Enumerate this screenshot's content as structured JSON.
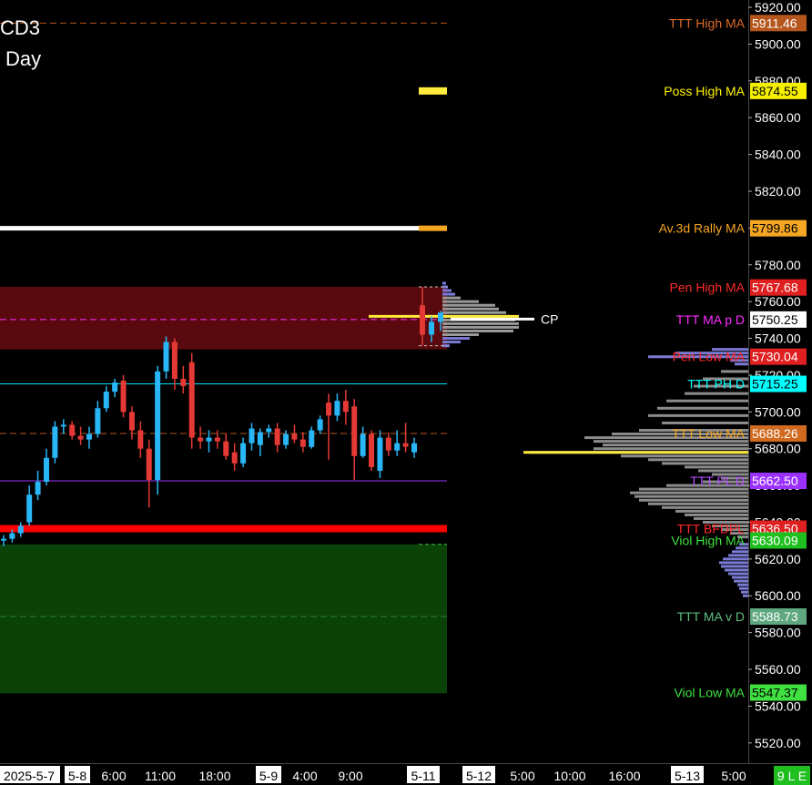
{
  "title_lines": [
    "CD3",
    "Day"
  ],
  "colors": {
    "bull": "#29b6f6",
    "bear": "#e53935",
    "yellow": "#ffeb3b",
    "white": "#ffffff"
  },
  "chart_data": {
    "type": "candlestick",
    "ylim": [
      5509,
      5924
    ],
    "y_ticks": [
      "5520.00",
      "5540.00",
      "5560.00",
      "5580.00",
      "5600.00",
      "5620.00",
      "5640.00",
      "5660.00",
      "5680.00",
      "5700.00",
      "5720.00",
      "5740.00",
      "5760.00",
      "5780.00",
      "5800.00",
      "5820.00",
      "5840.00",
      "5860.00",
      "5880.00",
      "5900.00",
      "5920.00"
    ],
    "x_labels": [
      "2025-5-7",
      "5-8",
      "6:00",
      "11:00",
      "18:00",
      "5-9",
      "4:00",
      "9:00",
      "5-11",
      "5-12",
      "5:00",
      "10:00",
      "16:00",
      "5-13",
      "5:00"
    ],
    "x_label_highlight": [
      "2025-5-7",
      "5-8",
      "5-9",
      "5-11",
      "5-12",
      "5-13"
    ],
    "corner_badge": "9 L E",
    "candles": [
      {
        "o": 5630,
        "h": 5633,
        "l": 5627,
        "c": 5631
      },
      {
        "o": 5631,
        "h": 5636,
        "l": 5629,
        "c": 5634
      },
      {
        "o": 5634,
        "h": 5640,
        "l": 5632,
        "c": 5638
      },
      {
        "o": 5640,
        "h": 5660,
        "l": 5638,
        "c": 5655
      },
      {
        "o": 5655,
        "h": 5668,
        "l": 5652,
        "c": 5662
      },
      {
        "o": 5662,
        "h": 5680,
        "l": 5660,
        "c": 5675
      },
      {
        "o": 5675,
        "h": 5695,
        "l": 5672,
        "c": 5692
      },
      {
        "o": 5692,
        "h": 5696,
        "l": 5688,
        "c": 5693
      },
      {
        "o": 5693,
        "h": 5695,
        "l": 5685,
        "c": 5687
      },
      {
        "o": 5687,
        "h": 5692,
        "l": 5682,
        "c": 5685
      },
      {
        "o": 5685,
        "h": 5692,
        "l": 5680,
        "c": 5688
      },
      {
        "o": 5688,
        "h": 5706,
        "l": 5686,
        "c": 5702
      },
      {
        "o": 5702,
        "h": 5714,
        "l": 5700,
        "c": 5711
      },
      {
        "o": 5711,
        "h": 5718,
        "l": 5708,
        "c": 5716
      },
      {
        "o": 5717,
        "h": 5720,
        "l": 5697,
        "c": 5700
      },
      {
        "o": 5700,
        "h": 5703,
        "l": 5685,
        "c": 5690
      },
      {
        "o": 5690,
        "h": 5695,
        "l": 5675,
        "c": 5680
      },
      {
        "o": 5680,
        "h": 5685,
        "l": 5648,
        "c": 5663
      },
      {
        "o": 5663,
        "h": 5725,
        "l": 5655,
        "c": 5722
      },
      {
        "o": 5722,
        "h": 5741,
        "l": 5718,
        "c": 5738
      },
      {
        "o": 5738,
        "h": 5740,
        "l": 5712,
        "c": 5718
      },
      {
        "o": 5718,
        "h": 5725,
        "l": 5710,
        "c": 5714
      },
      {
        "o": 5727,
        "h": 5732,
        "l": 5680,
        "c": 5686
      },
      {
        "o": 5686,
        "h": 5692,
        "l": 5680,
        "c": 5684
      },
      {
        "o": 5684,
        "h": 5690,
        "l": 5678,
        "c": 5686
      },
      {
        "o": 5686,
        "h": 5690,
        "l": 5680,
        "c": 5684
      },
      {
        "o": 5684,
        "h": 5688,
        "l": 5674,
        "c": 5676
      },
      {
        "o": 5678,
        "h": 5683,
        "l": 5668,
        "c": 5672
      },
      {
        "o": 5672,
        "h": 5686,
        "l": 5670,
        "c": 5683
      },
      {
        "o": 5683,
        "h": 5694,
        "l": 5679,
        "c": 5691
      },
      {
        "o": 5682,
        "h": 5691,
        "l": 5676,
        "c": 5689
      },
      {
        "o": 5689,
        "h": 5693,
        "l": 5686,
        "c": 5691
      },
      {
        "o": 5691,
        "h": 5694,
        "l": 5678,
        "c": 5682
      },
      {
        "o": 5682,
        "h": 5690,
        "l": 5680,
        "c": 5688
      },
      {
        "o": 5688,
        "h": 5693,
        "l": 5683,
        "c": 5685
      },
      {
        "o": 5685,
        "h": 5689,
        "l": 5678,
        "c": 5681
      },
      {
        "o": 5681,
        "h": 5692,
        "l": 5680,
        "c": 5690
      },
      {
        "o": 5690,
        "h": 5698,
        "l": 5688,
        "c": 5696
      },
      {
        "o": 5705,
        "h": 5710,
        "l": 5674,
        "c": 5698
      },
      {
        "o": 5698,
        "h": 5710,
        "l": 5695,
        "c": 5706
      },
      {
        "o": 5706,
        "h": 5712,
        "l": 5693,
        "c": 5700
      },
      {
        "o": 5703,
        "h": 5707,
        "l": 5663,
        "c": 5676
      },
      {
        "o": 5676,
        "h": 5692,
        "l": 5675,
        "c": 5688
      },
      {
        "o": 5688,
        "h": 5690,
        "l": 5668,
        "c": 5670
      },
      {
        "o": 5668,
        "h": 5690,
        "l": 5664,
        "c": 5686
      },
      {
        "o": 5686,
        "h": 5689,
        "l": 5676,
        "c": 5679
      },
      {
        "o": 5679,
        "h": 5690,
        "l": 5676,
        "c": 5683
      },
      {
        "o": 5683,
        "h": 5694,
        "l": 5678,
        "c": 5681
      },
      {
        "o": 5678,
        "h": 5686,
        "l": 5675,
        "c": 5683
      },
      {
        "o": 5758,
        "h": 5768,
        "l": 5736,
        "c": 5742
      },
      {
        "o": 5742,
        "h": 5752,
        "l": 5738,
        "c": 5749
      },
      {
        "o": 5749,
        "h": 5755,
        "l": 5744,
        "c": 5754
      }
    ],
    "zones": [
      {
        "name": "red-zone",
        "top": 5768,
        "bottom": 5734,
        "color": "#5a0a0e"
      },
      {
        "name": "green-zone",
        "top": 5628,
        "bottom": 5547,
        "color": "#0a4207"
      }
    ],
    "levels": [
      {
        "label": "TTT High MA",
        "value": "5911.46",
        "y": 5911.46,
        "text_color": "#e06a2a",
        "box_bg": "#b5561d",
        "box_fg": "#ffffff",
        "line": "dash",
        "line_color": "#b5561d",
        "line_width": 1
      },
      {
        "label": "Poss High MA",
        "value": "5874.55",
        "y": 5874.55,
        "text_color": "#fff200",
        "box_bg": "#f5f000",
        "box_fg": "#000000",
        "line": "none",
        "line_color": "#fff200",
        "line_width": 0
      },
      {
        "label": "Av.3d Rally MA",
        "value": "5799.86",
        "y": 5799.86,
        "text_color": "#f5a623",
        "box_bg": "#f5a623",
        "box_fg": "#000000",
        "line": "solid",
        "line_color": "#ffffff",
        "line_width": 5
      },
      {
        "label": "Pen High MA",
        "value": "5767.68",
        "y": 5767.68,
        "text_color": "#ff2a2a",
        "box_bg": "#e02020",
        "box_fg": "#ffffff",
        "line": "none",
        "line_color": "#e02020",
        "line_width": 0
      },
      {
        "label": "TTT MA p D",
        "value": "5750.25",
        "y": 5750.25,
        "text_color": "#ff2aff",
        "box_bg": "#ffffff",
        "box_fg": "#000000",
        "line": "dash",
        "line_color": "#ff2aff",
        "line_width": 1
      },
      {
        "label": "Pen Low MA",
        "value": "5730.04",
        "y": 5730.04,
        "text_color": "#ff2a2a",
        "box_bg": "#e02020",
        "box_fg": "#ffffff",
        "line": "none",
        "line_color": "#e02020",
        "line_width": 0
      },
      {
        "label": "TTT PH D",
        "value": "5715.25",
        "y": 5715.25,
        "text_color": "#00ffff",
        "box_bg": "#00ffff",
        "box_fg": "#000000",
        "line": "solid",
        "line_color": "#00e5ff",
        "line_width": 1
      },
      {
        "label": "TTT Low MA",
        "value": "5688.26",
        "y": 5688.26,
        "text_color": "#f5a623",
        "box_bg": "#d06a20",
        "box_fg": "#ffffff",
        "line": "dash",
        "line_color": "#b5561d",
        "line_width": 1
      },
      {
        "label": "TTT PL D",
        "value": "5662.50",
        "y": 5662.5,
        "text_color": "#b44dff",
        "box_bg": "#9b30ff",
        "box_fg": "#ffffff",
        "line": "solid",
        "line_color": "#9b30ff",
        "line_width": 1
      },
      {
        "label": "TTT BFDPL",
        "value": "5636.50",
        "y": 5636.5,
        "text_color": "#ff2a2a",
        "box_bg": "#e02020",
        "box_fg": "#ffffff",
        "line": "solid",
        "line_color": "#ff0000",
        "line_width": 8
      },
      {
        "label": "Viol High MA",
        "value": "5630.09",
        "y": 5630.09,
        "text_color": "#40e040",
        "box_bg": "#1fbf1f",
        "box_fg": "#ffffff",
        "line": "none",
        "line_color": "#1fbf1f",
        "line_width": 0
      },
      {
        "label": "TTT MA v D",
        "value": "5588.73",
        "y": 5588.73,
        "text_color": "#5fbf7f",
        "box_bg": "#5fa87f",
        "box_fg": "#ffffff",
        "line": "dash",
        "line_color": "#2f7f3f",
        "line_width": 1
      },
      {
        "label": "Viol Low MA",
        "value": "5547.37",
        "y": 5547.37,
        "text_color": "#40e040",
        "box_bg": "#40e040",
        "box_fg": "#000000",
        "line": "none",
        "line_color": "#40e040",
        "line_width": 0
      }
    ],
    "cp_label": "CP",
    "profile_small": [
      {
        "p": 5770,
        "w": 4
      },
      {
        "p": 5768,
        "w": 6
      },
      {
        "p": 5766,
        "w": 10
      },
      {
        "p": 5764,
        "w": 14
      },
      {
        "p": 5762,
        "w": 20
      },
      {
        "p": 5760,
        "w": 40
      },
      {
        "p": 5758,
        "w": 58
      },
      {
        "p": 5756,
        "w": 62
      },
      {
        "p": 5754,
        "w": 70
      },
      {
        "p": 5752,
        "w": 74
      },
      {
        "p": 5750,
        "w": 80
      },
      {
        "p": 5748,
        "w": 84
      },
      {
        "p": 5746,
        "w": 84
      },
      {
        "p": 5744,
        "w": 78
      },
      {
        "p": 5742,
        "w": 40
      },
      {
        "p": 5740,
        "w": 30
      },
      {
        "p": 5738,
        "w": 20
      },
      {
        "p": 5736,
        "w": 8
      }
    ],
    "profile_large": [
      {
        "p": 5734,
        "w": 40
      },
      {
        "p": 5732,
        "w": 80
      },
      {
        "p": 5730,
        "w": 110
      },
      {
        "p": 5728,
        "w": 20
      },
      {
        "p": 5726,
        "w": 15
      },
      {
        "p": 5722,
        "w": 30
      },
      {
        "p": 5718,
        "w": 50
      },
      {
        "p": 5714,
        "w": 60
      },
      {
        "p": 5710,
        "w": 70
      },
      {
        "p": 5706,
        "w": 90
      },
      {
        "p": 5702,
        "w": 100
      },
      {
        "p": 5698,
        "w": 110
      },
      {
        "p": 5694,
        "w": 95
      },
      {
        "p": 5690,
        "w": 120
      },
      {
        "p": 5688,
        "w": 150
      },
      {
        "p": 5686,
        "w": 180
      },
      {
        "p": 5684,
        "w": 170
      },
      {
        "p": 5682,
        "w": 160
      },
      {
        "p": 5680,
        "w": 170
      },
      {
        "p": 5678,
        "w": 240
      },
      {
        "p": 5676,
        "w": 140
      },
      {
        "p": 5674,
        "w": 110
      },
      {
        "p": 5672,
        "w": 95
      },
      {
        "p": 5670,
        "w": 70
      },
      {
        "p": 5668,
        "w": 55
      },
      {
        "p": 5666,
        "w": 40
      },
      {
        "p": 5664,
        "w": 30
      },
      {
        "p": 5662,
        "w": 50
      },
      {
        "p": 5660,
        "w": 90
      },
      {
        "p": 5658,
        "w": 120
      },
      {
        "p": 5656,
        "w": 130
      },
      {
        "p": 5654,
        "w": 125
      },
      {
        "p": 5652,
        "w": 120
      },
      {
        "p": 5650,
        "w": 110
      },
      {
        "p": 5648,
        "w": 95
      },
      {
        "p": 5646,
        "w": 80
      },
      {
        "p": 5644,
        "w": 70
      },
      {
        "p": 5642,
        "w": 60
      },
      {
        "p": 5640,
        "w": 50
      },
      {
        "p": 5638,
        "w": 40
      },
      {
        "p": 5636,
        "w": 30
      },
      {
        "p": 5634,
        "w": 20
      },
      {
        "p": 5632,
        "w": 12
      },
      {
        "p": 5628,
        "w": 10
      },
      {
        "p": 5626,
        "w": 14
      },
      {
        "p": 5624,
        "w": 18
      },
      {
        "p": 5622,
        "w": 22
      },
      {
        "p": 5620,
        "w": 28
      },
      {
        "p": 5618,
        "w": 32
      },
      {
        "p": 5616,
        "w": 30
      },
      {
        "p": 5614,
        "w": 26
      },
      {
        "p": 5612,
        "w": 22
      },
      {
        "p": 5610,
        "w": 18
      },
      {
        "p": 5608,
        "w": 16
      },
      {
        "p": 5606,
        "w": 12
      },
      {
        "p": 5604,
        "w": 10
      },
      {
        "p": 5602,
        "w": 8
      },
      {
        "p": 5600,
        "w": 6
      }
    ]
  }
}
